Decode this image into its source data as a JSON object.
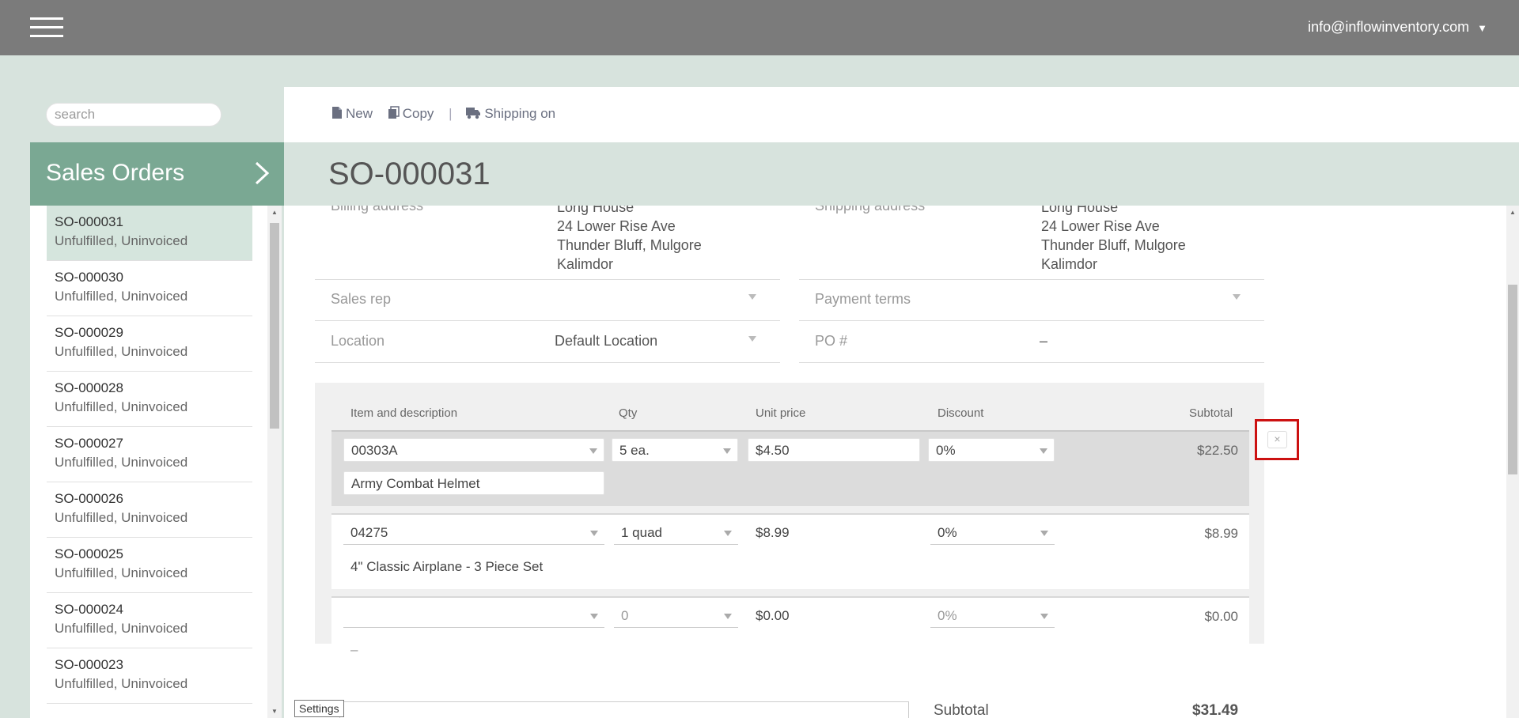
{
  "topbar": {
    "account_email": "info@inflowinventory.com",
    "caret": "▼"
  },
  "search": {
    "placeholder": "search"
  },
  "sidebar": {
    "title": "Sales Orders",
    "orders": [
      {
        "number": "SO-000031",
        "status": "Unfulfilled, Uninvoiced"
      },
      {
        "number": "SO-000030",
        "status": "Unfulfilled, Uninvoiced"
      },
      {
        "number": "SO-000029",
        "status": "Unfulfilled, Uninvoiced"
      },
      {
        "number": "SO-000028",
        "status": "Unfulfilled, Uninvoiced"
      },
      {
        "number": "SO-000027",
        "status": "Unfulfilled, Uninvoiced"
      },
      {
        "number": "SO-000026",
        "status": "Unfulfilled, Uninvoiced"
      },
      {
        "number": "SO-000025",
        "status": "Unfulfilled, Uninvoiced"
      },
      {
        "number": "SO-000024",
        "status": "Unfulfilled, Uninvoiced"
      },
      {
        "number": "SO-000023",
        "status": "Unfulfilled, Uninvoiced"
      }
    ]
  },
  "toolbar": {
    "new_label": "New",
    "copy_label": "Copy",
    "separator": "|",
    "shipping_label": "Shipping on"
  },
  "order": {
    "title": "SO-000031",
    "billing": {
      "label": "Billing address",
      "lines": [
        "Long House",
        "24 Lower Rise Ave",
        "Thunder Bluff, Mulgore",
        "Kalimdor"
      ]
    },
    "shipping": {
      "label": "Shipping address",
      "lines": [
        "Long House",
        "24 Lower Rise Ave",
        "Thunder Bluff, Mulgore",
        "Kalimdor"
      ]
    },
    "sales_rep": {
      "label": "Sales rep",
      "value": ""
    },
    "payment_terms": {
      "label": "Payment terms",
      "value": ""
    },
    "location": {
      "label": "Location",
      "value": "Default Location"
    },
    "po": {
      "label": "PO #",
      "value": "–"
    }
  },
  "items": {
    "headers": {
      "item": "Item and description",
      "qty": "Qty",
      "unit_price": "Unit price",
      "discount": "Discount",
      "subtotal": "Subtotal"
    },
    "rows": [
      {
        "item": "00303A",
        "qty": "5 ea.",
        "unit_price": "$4.50",
        "discount": "0%",
        "subtotal": "$22.50",
        "description": "Army Combat Helmet"
      },
      {
        "item": "04275",
        "qty": "1 quad",
        "unit_price": "$8.99",
        "discount": "0%",
        "subtotal": "$8.99",
        "description": "4\" Classic Airplane - 3 Piece Set"
      },
      {
        "item": "",
        "qty": "0",
        "unit_price": "$0.00",
        "discount": "0%",
        "subtotal": "$0.00",
        "description": "–"
      }
    ],
    "remove_symbol": "×"
  },
  "totals": {
    "subtotal_label": "Subtotal",
    "subtotal_value": "$31.49"
  },
  "tooltip": {
    "settings": "Settings"
  },
  "colors": {
    "topbar": "#7b7b7b",
    "accent": "#7aa893",
    "header_band": "#d7e3dd",
    "highlight": "#cc1111"
  }
}
